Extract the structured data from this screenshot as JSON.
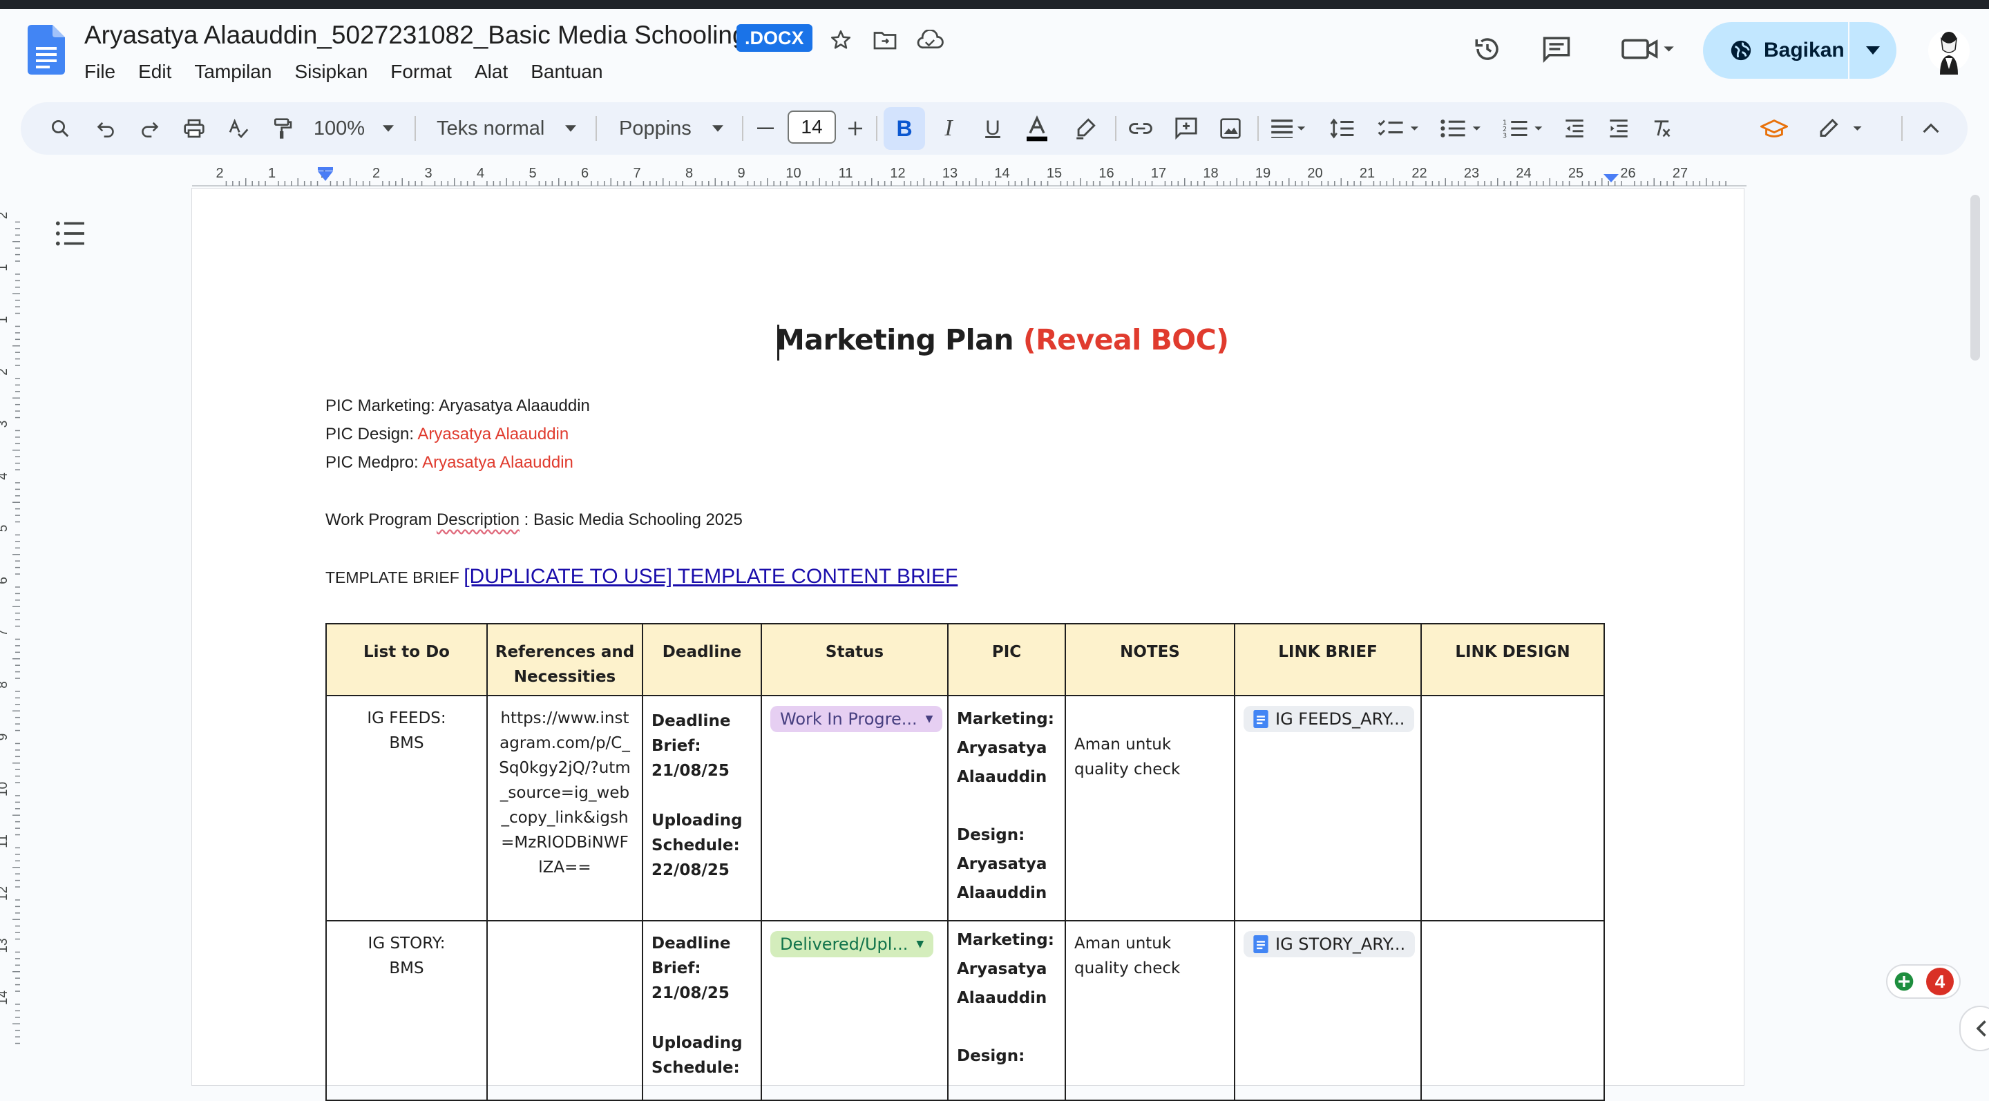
{
  "app": {
    "doc_title": "Aryasatya Alaauddin_5027231082_Basic Media Schooling",
    "file_badge": ".DOCX",
    "menu": [
      "File",
      "Edit",
      "Tampilan",
      "Sisipkan",
      "Format",
      "Alat",
      "Bantuan"
    ],
    "share_label": "Bagikan"
  },
  "toolbar": {
    "zoom": "100%",
    "style": "Teks normal",
    "font": "Poppins",
    "font_size": "14"
  },
  "ruler": {
    "h_ticks": [
      "2",
      "1",
      "1",
      "2",
      "3",
      "4",
      "5",
      "6",
      "7",
      "8",
      "9",
      "10",
      "11",
      "12",
      "13",
      "14",
      "15",
      "16",
      "17",
      "18",
      "19",
      "20",
      "21",
      "22",
      "23",
      "24",
      "25",
      "26",
      "27"
    ],
    "v_ticks": [
      "2",
      "1",
      "1",
      "2",
      "3",
      "4",
      "5",
      "6",
      "7",
      "8",
      "9",
      "10",
      "11",
      "12",
      "13",
      "14"
    ]
  },
  "document": {
    "heading": "Marketing Plan",
    "heading_accent": "(Reveal BOC)",
    "pic_marketing_label": "PIC Marketing:",
    "pic_marketing_value": "Aryasatya Alaauddin",
    "pic_design_label": "PIC Design:",
    "pic_design_value": "Aryasatya Alaauddin",
    "pic_medpro_label": "PIC Medpro:",
    "pic_medpro_value": "Aryasatya Alaauddin",
    "work_program_prefix": "Work Program",
    "work_program_word": "Description",
    "work_program_suffix": " : Basic Media Schooling 2025",
    "template_label": "TEMPLATE BRIEF",
    "template_link": "[DUPLICATE TO USE] TEMPLATE CONTENT BRIEF"
  },
  "table": {
    "headers": [
      "List to Do",
      "References and Necessities",
      "Deadline",
      "Status",
      "PIC",
      "NOTES",
      "LINK BRIEF",
      "LINK DESIGN"
    ],
    "rows": [
      {
        "task_line1": "IG FEEDS:",
        "task_line2": "BMS",
        "reference": "https://www.instagram.com/p/C_Sq0kgy2jQ/?utm_source=ig_web_copy_link&igsh=MzRlODBiNWFlZA==",
        "deadline_brief_label": "Deadline Brief:",
        "deadline_brief_date": "21/08/25",
        "upload_label": "Uploading Schedule:",
        "upload_date": "22/08/25",
        "status": "Work In Progre...",
        "pic_marketing_label": "Marketing:",
        "pic_marketing_name": "Aryasatya Alaauddin",
        "pic_design_label": "Design:",
        "pic_design_name": "Aryasatya Alaauddin",
        "notes": "Aman untuk quality check",
        "link_brief": "IG FEEDS_ARY..."
      },
      {
        "task_line1": "IG STORY:",
        "task_line2": "BMS",
        "reference": "",
        "deadline_brief_label": "Deadline Brief:",
        "deadline_brief_date": "21/08/25",
        "upload_label": "Uploading Schedule:",
        "upload_date": "",
        "status": "Delivered/Upl...",
        "pic_marketing_label": "Marketing:",
        "pic_marketing_name": "Aryasatya Alaauddin",
        "pic_design_label": "Design:",
        "pic_design_name": "",
        "notes": "Aman untuk quality check",
        "link_brief": "IG STORY_ARY..."
      }
    ]
  },
  "floating": {
    "badge_count": "4"
  },
  "colors": {
    "accent_red": "#e03b2e",
    "share_bg": "#c2e7ff",
    "header_fill": "#fdf2cc",
    "link": "#1a0dab"
  }
}
